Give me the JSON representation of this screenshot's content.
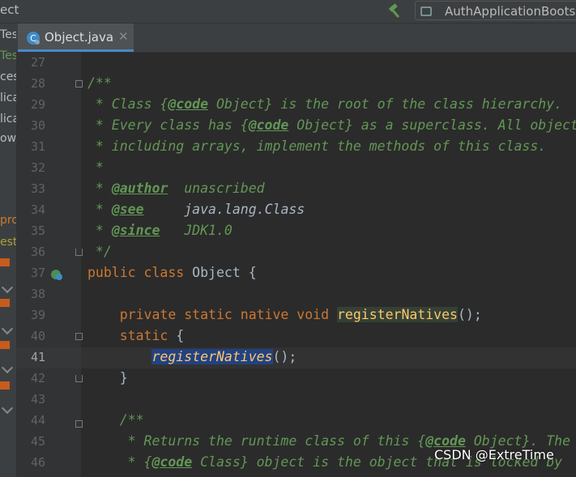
{
  "window": {
    "project_fragment": "ect",
    "run_config_label": "AuthApplicationBoots"
  },
  "sidebar": {
    "items": [
      {
        "label": "Tes",
        "color": "#bbbbbb"
      },
      {
        "label": "Tes",
        "color": "#629755"
      },
      {
        "label": "ces",
        "color": "#bbbbbb"
      },
      {
        "label": "lica",
        "color": "#bbbbbb"
      },
      {
        "label": "lica",
        "color": "#bbbbbb"
      },
      {
        "label": "ow",
        "color": "#bbbbbb"
      },
      {
        "label": "pro",
        "color": "#c77d2e"
      },
      {
        "label": "est",
        "color": "#a8a23a"
      }
    ]
  },
  "editor_tab": {
    "label": "Object.java",
    "close_glyph": "✕"
  },
  "line_numbers": [
    "27",
    "28",
    "29",
    "30",
    "31",
    "32",
    "33",
    "34",
    "35",
    "36",
    "37",
    "38",
    "39",
    "40",
    "41",
    "42",
    "43",
    "44",
    "45",
    "46"
  ],
  "code": {
    "l28_open": "/**",
    "l29_a": " * Class {",
    "l29_tag": "@code",
    "l29_b": " Object} is the root of the class hierarchy.",
    "l30_a": " * Every class has {",
    "l30_tag": "@code",
    "l30_b": " Object} as a superclass. All objects,",
    "l31": " * including arrays, implement the methods of this class.",
    "l32": " *",
    "l33_a": " * ",
    "l33_tag": "@author",
    "l33_b": "  unascribed",
    "l34_a": " * ",
    "l34_tag": "@see",
    "l34_b": "     java.lang.Class",
    "l35_a": " * ",
    "l35_tag": "@since",
    "l35_b": "   JDK1.0",
    "l36": " */",
    "l37_kw": "public class",
    "l37_rest": " Object {",
    "l39_indent": "    ",
    "l39_kw": "private static native void",
    "l39_sp": " ",
    "l39_method": "registerNatives",
    "l39_end": "();",
    "l40_indent": "    ",
    "l40_kw": "static",
    "l40_rest": " {",
    "l41_indent": "        ",
    "l41_method": "registerNatives",
    "l41_end": "();",
    "l42": "    }",
    "l44": "    /**",
    "l45_a": "     * Returns the runtime class of this {",
    "l45_tag": "@code",
    "l45_b": " Object}. The",
    "l46_a": "     * {",
    "l46_tag": "@code",
    "l46_b": " Class} object is the object that is locked by"
  },
  "watermark": "CSDN @ExtreTime",
  "colors": {
    "keyword": "#cc7832",
    "comment": "#629755",
    "method": "#ffc66d",
    "plain": "#a9b7c6",
    "selection": "#214283",
    "tab_underline": "#4a88c7"
  }
}
